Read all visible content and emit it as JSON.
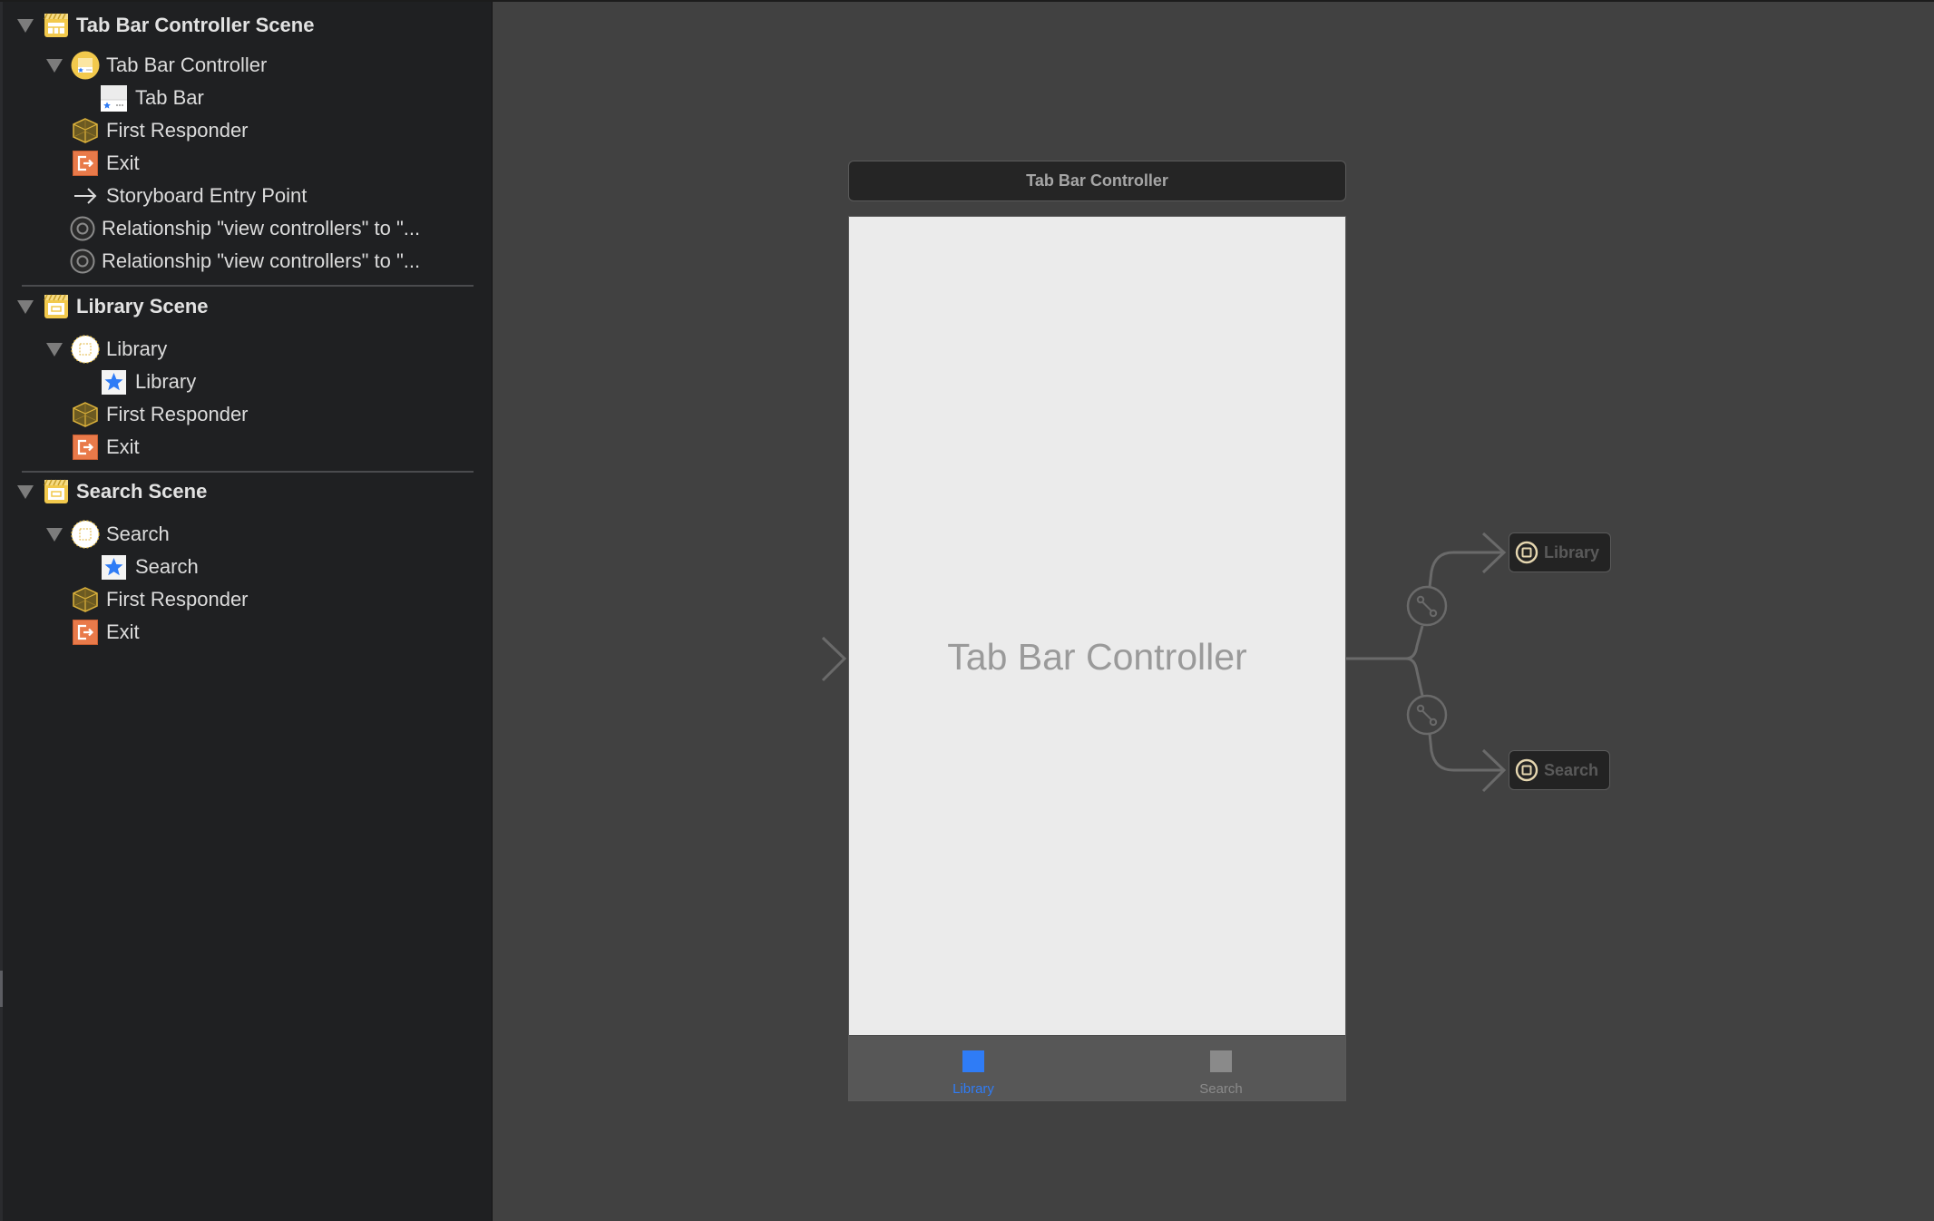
{
  "outline": {
    "scenes": [
      {
        "title": "Tab Bar Controller Scene",
        "items": [
          {
            "label": "Tab Bar Controller",
            "icon": "tab-bar-controller-icon"
          },
          {
            "label": "Tab Bar",
            "icon": "tab-bar-icon"
          },
          {
            "label": "First Responder",
            "icon": "first-responder-cube-icon"
          },
          {
            "label": "Exit",
            "icon": "exit-icon"
          },
          {
            "label": "Storyboard Entry Point",
            "icon": "arrow-right-icon"
          },
          {
            "label": "Relationship \"view controllers\" to \"...",
            "icon": "relationship-icon"
          },
          {
            "label": "Relationship \"view controllers\" to \"...",
            "icon": "relationship-icon"
          }
        ]
      },
      {
        "title": "Library Scene",
        "items": [
          {
            "label": "Library",
            "icon": "view-controller-icon"
          },
          {
            "label": "Library",
            "icon": "tab-bar-item-star-icon"
          },
          {
            "label": "First Responder",
            "icon": "first-responder-cube-icon"
          },
          {
            "label": "Exit",
            "icon": "exit-icon"
          }
        ]
      },
      {
        "title": "Search Scene",
        "items": [
          {
            "label": "Search",
            "icon": "view-controller-icon"
          },
          {
            "label": "Search",
            "icon": "tab-bar-item-star-icon"
          },
          {
            "label": "First Responder",
            "icon": "first-responder-cube-icon"
          },
          {
            "label": "Exit",
            "icon": "exit-icon"
          }
        ]
      }
    ]
  },
  "canvas": {
    "scene_header": "Tab Bar Controller",
    "view_title": "Tab Bar Controller",
    "tabs": [
      {
        "label": "Library",
        "selected": true,
        "color": "#2f7cf6"
      },
      {
        "label": "Search",
        "selected": false,
        "color": "#8a8a8a"
      }
    ],
    "segues": [
      {
        "label": "Library",
        "icon": "view-controller-ref-icon"
      },
      {
        "label": "Search",
        "icon": "view-controller-ref-icon"
      }
    ]
  },
  "colors": {
    "sidebar_bg": "#1f2022",
    "canvas_bg": "#414141",
    "accent_blue": "#2f7cf6",
    "scene_yellow": "#f2c94c",
    "exit_orange": "#e97a4a"
  }
}
